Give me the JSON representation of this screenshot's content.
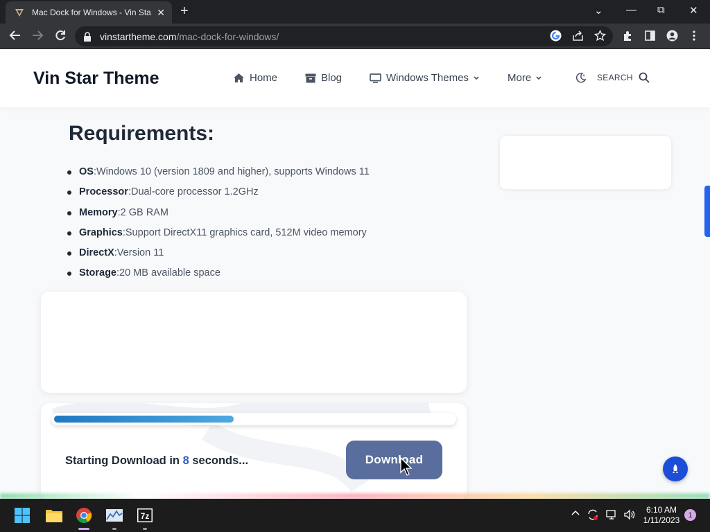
{
  "browser": {
    "tab_title": "Mac Dock for Windows - Vin Star",
    "tab_close": "✕",
    "new_tab": "+",
    "url_domain": "vinstartheme.com",
    "url_path": "/mac-dock-for-windows/",
    "window_controls": {
      "dropdown": "⌄",
      "minimize": "—",
      "restore": "⧉",
      "close": "✕"
    }
  },
  "site": {
    "brand": "Vin Star Theme",
    "nav": {
      "home": "Home",
      "blog": "Blog",
      "windows_themes": "Windows Themes",
      "more": "More",
      "search": "SEARCH"
    }
  },
  "content": {
    "requirements_title": "Requirements:",
    "requirements": [
      {
        "label": "OS",
        "value": ":Windows 10 (version 1809 and higher), supports Windows 11"
      },
      {
        "label": "Processor",
        "value": ":Dual-core processor 1.2GHz"
      },
      {
        "label": "Memory",
        "value": ":2 GB RAM"
      },
      {
        "label": "Graphics",
        "value": ":Support DirectX11 graphics card, 512M video memory"
      },
      {
        "label": "DirectX",
        "value": ":Version 11"
      },
      {
        "label": "Storage",
        "value": ":20 MB available space"
      }
    ]
  },
  "download": {
    "progress_percent": 45,
    "text_prefix": "Starting Download in ",
    "seconds": "8",
    "text_suffix": " seconds...",
    "button_label": "Download"
  },
  "taskbar": {
    "time": "6:10 AM",
    "date": "1/11/2023",
    "notification_count": "1"
  },
  "colors": {
    "accent": "#2563eb",
    "download_button": "#596e9c",
    "progress": "#1e78c2"
  }
}
